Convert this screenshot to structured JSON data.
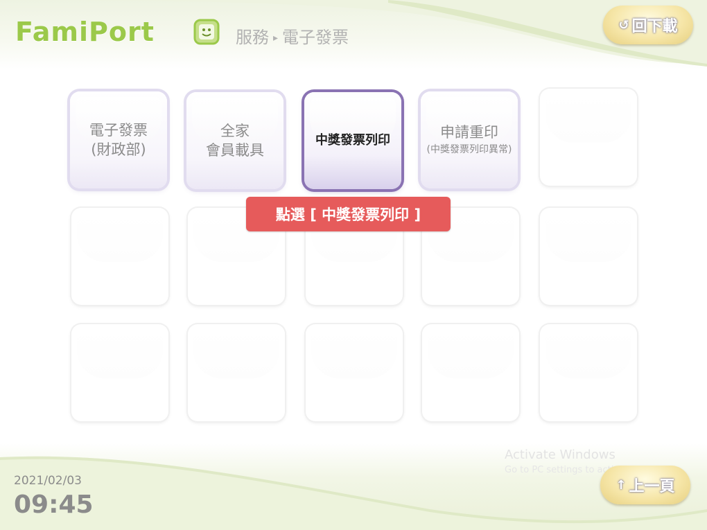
{
  "header": {
    "logo_text": "FamiPort",
    "breadcrumb_section": "服務",
    "breadcrumb_arrow": "▸",
    "breadcrumb_page": "電子發票",
    "home_button_icon": "refresh-arrow-icon",
    "home_button_label": "回下載"
  },
  "tiles": {
    "row1": [
      {
        "line1": "電子發票",
        "line2": "(財政部)"
      },
      {
        "line1": "全家",
        "line2": "會員載具"
      },
      {
        "line1": "中獎發票列印"
      },
      {
        "line1": "申請重印",
        "line3": "(中獎發票列印異常)"
      }
    ]
  },
  "callout": {
    "text": "點選 [ 中獎發票列印 ]"
  },
  "footer": {
    "date": "2021/02/03",
    "time": "09:45",
    "back_button_icon": "up-arrow-icon",
    "back_button_arrow": "↑",
    "back_button_label": "上一頁"
  },
  "watermark": {
    "line1": "Activate Windows",
    "line2": "Go to PC settings to activate Windows."
  },
  "colors": {
    "logo_green": "#9bc94a",
    "callout_red": "#e65b5b",
    "selected_purple": "#8a73b3",
    "button_gold": "#f6e6a8"
  }
}
